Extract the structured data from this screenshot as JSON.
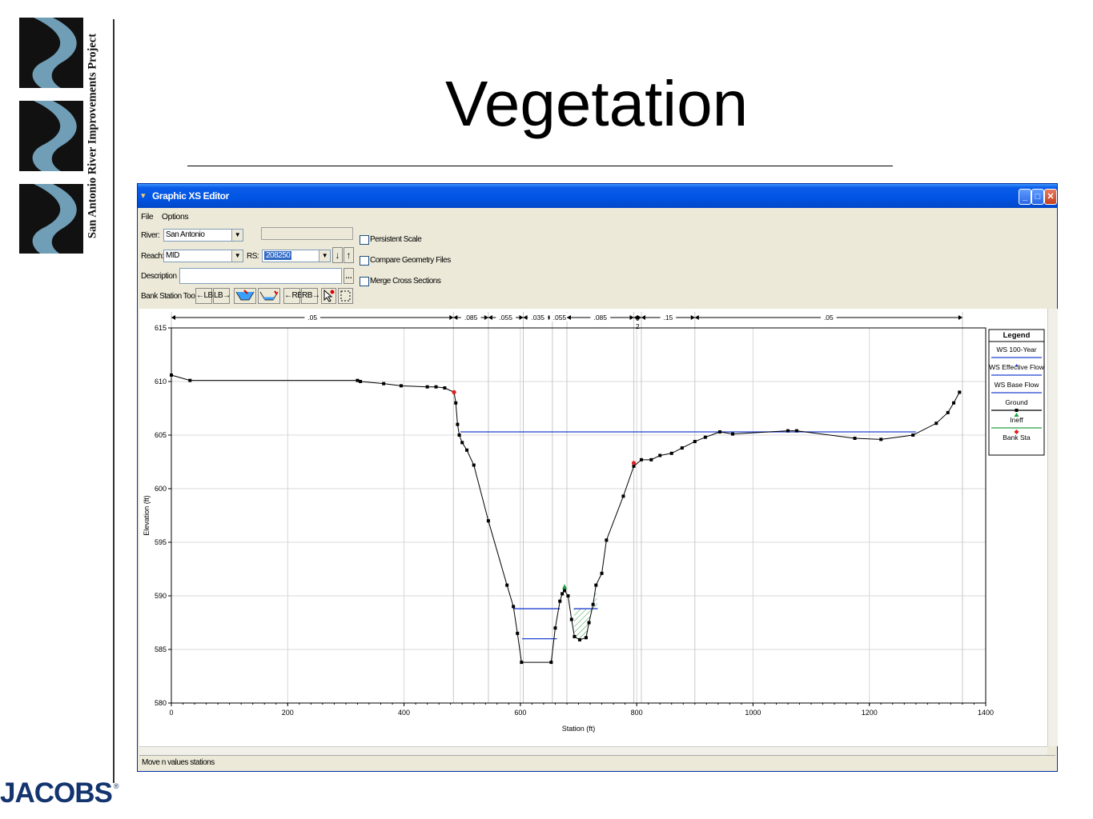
{
  "slide": {
    "title": "Vegetation",
    "side_text": "San Antonio River Improvements Project",
    "footer_logo": "JACOBS",
    "footer_mark": "®"
  },
  "window": {
    "title": "Graphic XS Editor",
    "menu": [
      "File",
      "Options"
    ],
    "river_label": "River:",
    "river_value": "San Antonio",
    "reach_label": "Reach:",
    "reach_value": "MID",
    "rs_label": "RS:",
    "rs_value": "208250",
    "description_label": "Description",
    "bank_tools_label": "Bank Station Tools:",
    "tool_buttons": [
      "←LB",
      "LB→",
      "←RB",
      "RB→"
    ],
    "checkboxes": [
      "Persistent Scale",
      "Compare Geometry Files",
      "Merge Cross Sections"
    ],
    "status": "Move n values stations"
  },
  "chart_data": {
    "type": "line",
    "xlabel": "Station (ft)",
    "ylabel": "Elevation (ft)",
    "xlim": [
      0,
      1400
    ],
    "ylim": [
      580,
      615
    ],
    "xticks": [
      0,
      200,
      400,
      600,
      800,
      1000,
      1200,
      1400
    ],
    "yticks": [
      580,
      585,
      590,
      595,
      600,
      605,
      610,
      615
    ],
    "grid": true,
    "legend_position": "right",
    "legend_title": "Legend",
    "legend": [
      {
        "name": "WS 100-Year",
        "color": "#2040d0"
      },
      {
        "name": "WS Effective Flow",
        "color": "#2040d0"
      },
      {
        "name": "WS Base Flow",
        "color": "#2040d0"
      },
      {
        "name": "Ground",
        "color": "#000000"
      },
      {
        "name": "Ineff",
        "color": "#22a040"
      },
      {
        "name": "Bank Sta",
        "color": "#e02020"
      }
    ],
    "n_values": [
      {
        "from": 0,
        "to": 485,
        "label": ".05"
      },
      {
        "from": 485,
        "to": 545,
        "label": ".085"
      },
      {
        "from": 545,
        "to": 605,
        "label": ".055"
      },
      {
        "from": 605,
        "to": 655,
        "label": ".035"
      },
      {
        "from": 655,
        "to": 680,
        "label": ".055"
      },
      {
        "from": 680,
        "to": 795,
        "label": ".085"
      },
      {
        "from": 795,
        "to": 808,
        "label": "0 2"
      },
      {
        "from": 808,
        "to": 900,
        "label": ".15"
      },
      {
        "from": 900,
        "to": 1360,
        "label": ".05"
      }
    ],
    "ground": [
      [
        0,
        610.6
      ],
      [
        32,
        610.1
      ],
      [
        320,
        610.1
      ],
      [
        325,
        610.0
      ],
      [
        365,
        609.8
      ],
      [
        395,
        609.6
      ],
      [
        440,
        609.5
      ],
      [
        455,
        609.5
      ],
      [
        470,
        609.4
      ],
      [
        486,
        609.0
      ],
      [
        489,
        608.0
      ],
      [
        492,
        606.0
      ],
      [
        495,
        605.0
      ],
      [
        500,
        604.3
      ],
      [
        508,
        603.6
      ],
      [
        520,
        602.2
      ],
      [
        545,
        597.0
      ],
      [
        577,
        591.0
      ],
      [
        588,
        589.0
      ],
      [
        595,
        586.5
      ],
      [
        602,
        583.8
      ],
      [
        653,
        583.8
      ],
      [
        660,
        587.0
      ],
      [
        668,
        589.5
      ],
      [
        672,
        590.2
      ],
      [
        676,
        590.5
      ],
      [
        682,
        590.0
      ],
      [
        688,
        587.8
      ],
      [
        693,
        586.2
      ],
      [
        702,
        585.9
      ],
      [
        713,
        586.1
      ],
      [
        718,
        587.5
      ],
      [
        725,
        589.2
      ],
      [
        730,
        591.0
      ],
      [
        740,
        592.1
      ],
      [
        748,
        595.2
      ],
      [
        777,
        599.3
      ],
      [
        795,
        602.1
      ],
      [
        808,
        602.7
      ],
      [
        825,
        602.7
      ],
      [
        840,
        603.1
      ],
      [
        860,
        603.3
      ],
      [
        878,
        603.8
      ],
      [
        900,
        604.4
      ],
      [
        918,
        604.8
      ],
      [
        943,
        605.3
      ],
      [
        965,
        605.1
      ],
      [
        1060,
        605.4
      ],
      [
        1075,
        605.4
      ],
      [
        1175,
        604.7
      ],
      [
        1220,
        604.6
      ],
      [
        1275,
        605.0
      ],
      [
        1315,
        606.1
      ],
      [
        1335,
        607.1
      ],
      [
        1345,
        608.0
      ],
      [
        1355,
        609.0
      ]
    ],
    "ws_100_year": [
      [
        497,
        605.3
      ],
      [
        1280,
        605.3
      ]
    ],
    "ws_effective_flow": [
      [
        588,
        588.8
      ],
      [
        668,
        588.8
      ]
    ],
    "ws_base_flow": [
      [
        603,
        586.0
      ],
      [
        663,
        586.0
      ]
    ],
    "right_pool_ws": [
      [
        692,
        588.8
      ],
      [
        733,
        588.8
      ]
    ],
    "bank_stations": [
      [
        486,
        609.0
      ],
      [
        795,
        602.4
      ]
    ],
    "ineffective_marker": [
      676,
      590.8
    ]
  }
}
